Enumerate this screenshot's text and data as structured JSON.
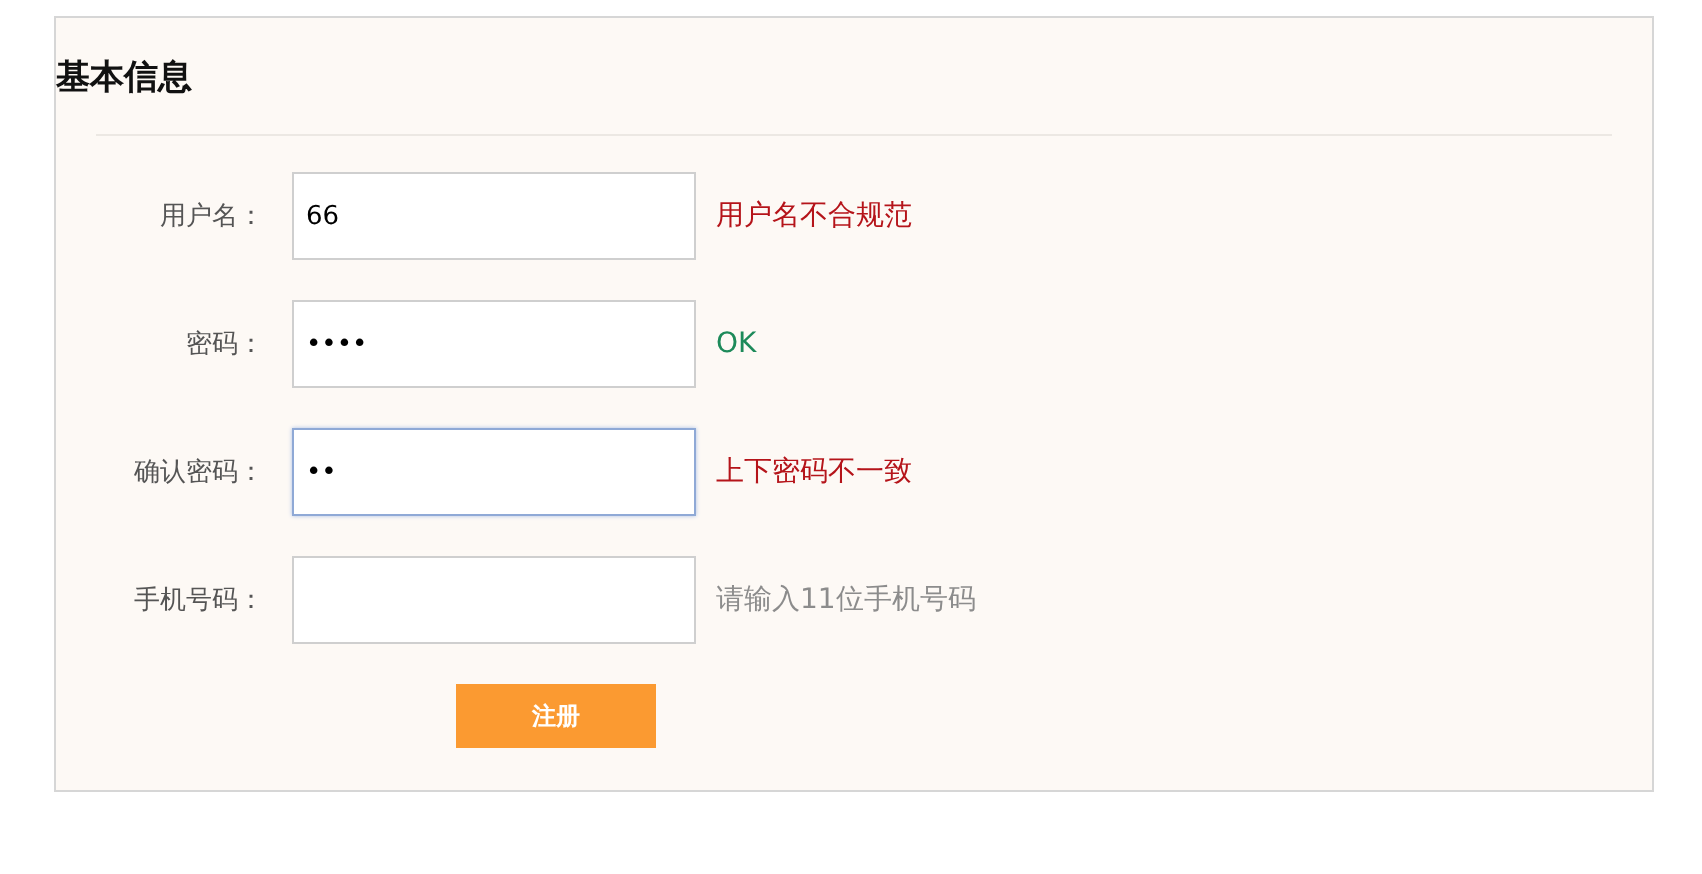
{
  "section": {
    "title": "基本信息"
  },
  "fields": [
    {
      "label": "用户名：",
      "value": "66",
      "focused": false,
      "message": {
        "text": "用户名不合规范",
        "kind": "error"
      }
    },
    {
      "label": "密码：",
      "value": "••••",
      "focused": false,
      "message": {
        "text": "OK",
        "kind": "ok"
      }
    },
    {
      "label": "确认密码：",
      "value": "••",
      "focused": true,
      "message": {
        "text": "上下密码不一致",
        "kind": "error"
      }
    },
    {
      "label": "手机号码：",
      "focused": false,
      "message": {
        "text": "请输入11位手机号码",
        "kind": "hint"
      }
    }
  ],
  "submit": {
    "label": "注册"
  }
}
